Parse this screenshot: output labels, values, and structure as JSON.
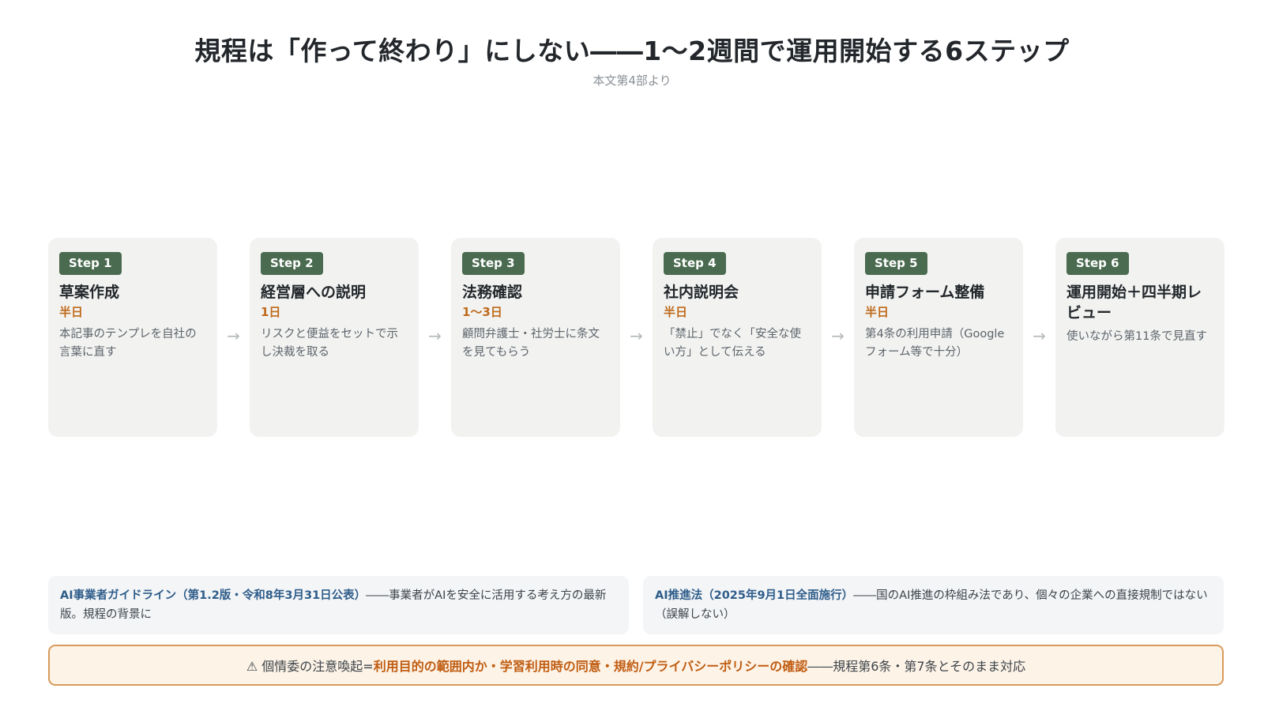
{
  "header": {
    "title": "規程は「作って終わり」にしない――1〜2週間で運用開始する6ステップ",
    "subtitle": "本文第4部より"
  },
  "arrow_glyph": "→",
  "steps": [
    {
      "badge": "Step 1",
      "title": "草案作成",
      "duration": "半日",
      "desc": "本記事のテンプレを自社の言葉に直す"
    },
    {
      "badge": "Step 2",
      "title": "経営層への説明",
      "duration": "1日",
      "desc": "リスクと便益をセットで示し決裁を取る"
    },
    {
      "badge": "Step 3",
      "title": "法務確認",
      "duration": "1〜3日",
      "desc": "顧問弁護士・社労士に条文を見てもらう"
    },
    {
      "badge": "Step 4",
      "title": "社内説明会",
      "duration": "半日",
      "desc": "「禁止」でなく「安全な使い方」として伝える"
    },
    {
      "badge": "Step 5",
      "title": "申請フォーム整備",
      "duration": "半日",
      "desc": "第4条の利用申請（Googleフォーム等で十分）"
    },
    {
      "badge": "Step 6",
      "title": "運用開始＋四半期レビュー",
      "duration": "",
      "desc": "使いながら第11条で見直す"
    }
  ],
  "notes": [
    {
      "highlight": "AI事業者ガイドライン（第1.2版・令和8年3月31日公表）",
      "text": "――事業者がAIを安全に活用する考え方の最新版。規程の背景に"
    },
    {
      "highlight": "AI推進法（2025年9月1日全面施行）",
      "text": "――国のAI推進の枠組み法であり、個々の企業への直接規制ではない（誤解しない）"
    }
  ],
  "warning": {
    "prefix": "⚠ 個情委の注意喚起=",
    "highlight": "利用目的の範囲内か・学習利用時の同意・規約/プライバシーポリシーの確認",
    "suffix": "――規程第6条・第7条とそのまま対応"
  },
  "colors": {
    "badge_bg": "#4a6b4f",
    "duration": "#bf6a1b",
    "note_highlight": "#2f5d8a",
    "warning_border": "#d99a5b",
    "warning_highlight": "#c05d12"
  }
}
